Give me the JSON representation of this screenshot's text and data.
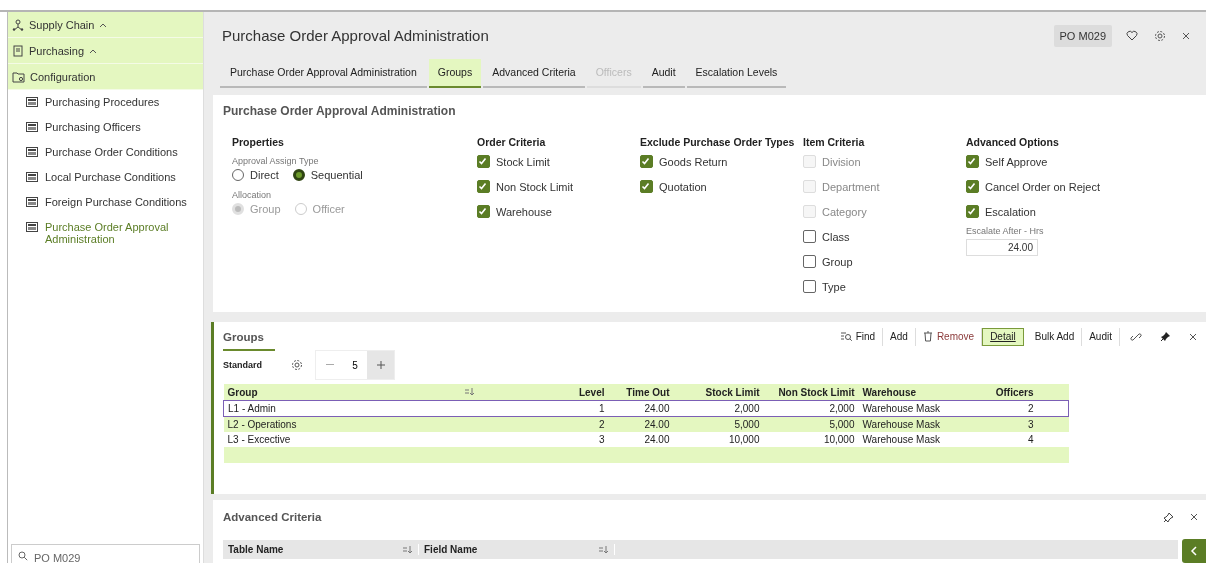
{
  "sidebar": {
    "sections": [
      {
        "label": "Supply Chain",
        "kind": "network",
        "expanded": true
      },
      {
        "label": "Purchasing",
        "kind": "document",
        "expanded": true
      },
      {
        "label": "Configuration",
        "kind": "folder"
      }
    ],
    "pages": [
      {
        "label": "Purchasing Procedures",
        "selected": false
      },
      {
        "label": "Purchasing Officers",
        "selected": false
      },
      {
        "label": "Purchase Order Conditions",
        "selected": false
      },
      {
        "label": "Local Purchase Conditions",
        "selected": false
      },
      {
        "label": "Foreign Purchase Conditions",
        "selected": false
      },
      {
        "label": "Purchase Order Approval Administration",
        "selected": true
      }
    ],
    "search": {
      "value": "PO M029"
    }
  },
  "header": {
    "title": "Purchase Order Approval Administration",
    "code": "PO M029",
    "tabs": [
      {
        "label": "Purchase Order Approval Administration",
        "selected": false,
        "disabled": false
      },
      {
        "label": "Groups",
        "selected": true,
        "disabled": false
      },
      {
        "label": "Advanced Criteria",
        "selected": false,
        "disabled": false
      },
      {
        "label": "Officers",
        "selected": false,
        "disabled": true
      },
      {
        "label": "Audit",
        "selected": false,
        "disabled": false
      },
      {
        "label": "Escalation Levels",
        "selected": false,
        "disabled": false
      }
    ]
  },
  "properties_panel": {
    "title": "Purchase Order Approval Administration",
    "properties": {
      "heading": "Properties",
      "radio_groups": [
        {
          "label": "Approval Assign Type",
          "disabled": false,
          "options": [
            {
              "label": "Direct",
              "selected": false
            },
            {
              "label": "Sequential",
              "selected": true
            }
          ]
        },
        {
          "label": "Allocation",
          "disabled": true,
          "options": [
            {
              "label": "Group",
              "selected": true
            },
            {
              "label": "Officer",
              "selected": false
            }
          ]
        }
      ]
    },
    "columns": [
      {
        "heading": "Order Criteria",
        "items": [
          {
            "label": "Stock Limit",
            "checked": true,
            "disabled": false
          },
          {
            "label": "Non Stock Limit",
            "checked": true,
            "disabled": false
          },
          {
            "label": "Warehouse",
            "checked": true,
            "disabled": false
          }
        ]
      },
      {
        "heading": "Exclude Purchase Order Types",
        "items": [
          {
            "label": "Goods Return",
            "checked": true,
            "disabled": false
          },
          {
            "label": "Quotation",
            "checked": true,
            "disabled": false
          }
        ]
      },
      {
        "heading": "Item Criteria",
        "items": [
          {
            "label": "Division",
            "checked": false,
            "disabled": true
          },
          {
            "label": "Department",
            "checked": false,
            "disabled": true
          },
          {
            "label": "Category",
            "checked": false,
            "disabled": true
          },
          {
            "label": "Class",
            "checked": false,
            "disabled": false
          },
          {
            "label": "Group",
            "checked": false,
            "disabled": false
          },
          {
            "label": "Type",
            "checked": false,
            "disabled": false
          }
        ]
      },
      {
        "heading": "Advanced Options",
        "items": [
          {
            "label": "Self Approve",
            "checked": true,
            "disabled": false
          },
          {
            "label": "Cancel Order on Reject",
            "checked": true,
            "disabled": false
          },
          {
            "label": "Escalation",
            "checked": true,
            "disabled": false
          }
        ],
        "field": {
          "label": "Escalate After - Hrs",
          "value": "24.00"
        }
      }
    ]
  },
  "groups_panel": {
    "title": "Groups",
    "toolbar": [
      {
        "label": "Find",
        "kind": "find",
        "selected": false
      },
      {
        "label": "Add",
        "kind": "plain",
        "selected": false
      },
      {
        "label": "Remove",
        "kind": "remove",
        "selected": false
      },
      {
        "label": "Detail",
        "kind": "plain",
        "selected": true
      },
      {
        "label": "Bulk Add",
        "kind": "plain",
        "selected": false
      },
      {
        "label": "Audit",
        "kind": "plain",
        "selected": false
      }
    ],
    "view_tab": "Standard",
    "stepper": {
      "value": "5"
    },
    "table": {
      "columns": [
        "Group",
        "Level",
        "Time Out",
        "Stock Limit",
        "Non Stock Limit",
        "Warehouse",
        "Officers"
      ],
      "rows": [
        {
          "cells": [
            "L1 - Admin",
            "1",
            "24.00",
            "2,000",
            "2,000",
            "Warehouse Mask",
            "2"
          ],
          "selected": true
        },
        {
          "cells": [
            "L2 - Operations",
            "2",
            "24.00",
            "5,000",
            "5,000",
            "Warehouse Mask",
            "3"
          ],
          "selected": false
        },
        {
          "cells": [
            "L3 - Excective",
            "3",
            "24.00",
            "10,000",
            "10,000",
            "Warehouse Mask",
            "4"
          ],
          "selected": false
        }
      ]
    }
  },
  "advanced_panel": {
    "title": "Advanced Criteria",
    "table": {
      "columns": [
        "Table Name",
        "Field Name"
      ]
    }
  }
}
